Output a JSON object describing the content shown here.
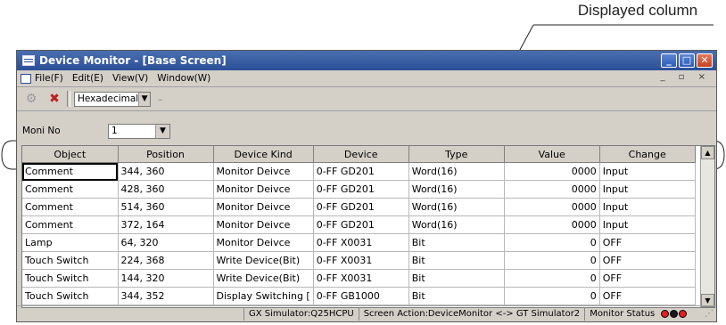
{
  "callout": {
    "text": "Displayed column"
  },
  "window": {
    "title": "Device Monitor - [Base Screen]",
    "controls": {
      "minimize": "_",
      "maximize": "□",
      "close": "✕"
    }
  },
  "menu": {
    "items": [
      "File(F)",
      "Edit(E)",
      "View(V)",
      "Window(W)"
    ],
    "mdi_controls": "_ ▫ ×"
  },
  "toolbar": {
    "format_select": "Hexadecimal",
    "icons": [
      "monitor-start-icon",
      "monitor-stop-icon"
    ]
  },
  "moni": {
    "label": "Moni No",
    "value": "1"
  },
  "table": {
    "headers": [
      "Object",
      "Position",
      "Device Kind",
      "Device",
      "Type",
      "Value",
      "Change"
    ],
    "rows": [
      [
        "Comment",
        "344, 360",
        "Monitor Deivce",
        "0-FF GD201",
        "Word(16)",
        "0000",
        "Input"
      ],
      [
        "Comment",
        "428, 360",
        "Monitor Deivce",
        "0-FF GD201",
        "Word(16)",
        "0000",
        "Input"
      ],
      [
        "Comment",
        "514, 360",
        "Monitor Deivce",
        "0-FF GD201",
        "Word(16)",
        "0000",
        "Input"
      ],
      [
        "Comment",
        "372, 164",
        "Monitor Deivce",
        "0-FF GD201",
        "Word(16)",
        "0000",
        "Input"
      ],
      [
        "Lamp",
        "64, 320",
        "Monitor Deivce",
        "0-FF X0031",
        "Bit",
        "0",
        "OFF"
      ],
      [
        "Touch Switch",
        "224, 368",
        "Write Device(Bit)",
        "0-FF X0031",
        "Bit",
        "0",
        "OFF"
      ],
      [
        "Touch Switch",
        "144, 320",
        "Write Device(Bit)",
        "0-FF X0031",
        "Bit",
        "0",
        "OFF"
      ],
      [
        "Touch Switch",
        "344, 352",
        "Display Switching [",
        "0-FF GB1000",
        "Bit",
        "0",
        "OFF"
      ]
    ]
  },
  "status": {
    "simulator": "GX Simulator:Q25HCPU",
    "screen_action": "Screen Action:DeviceMonitor <-> GT Simulator2",
    "monitor_status": "Monitor Status"
  }
}
